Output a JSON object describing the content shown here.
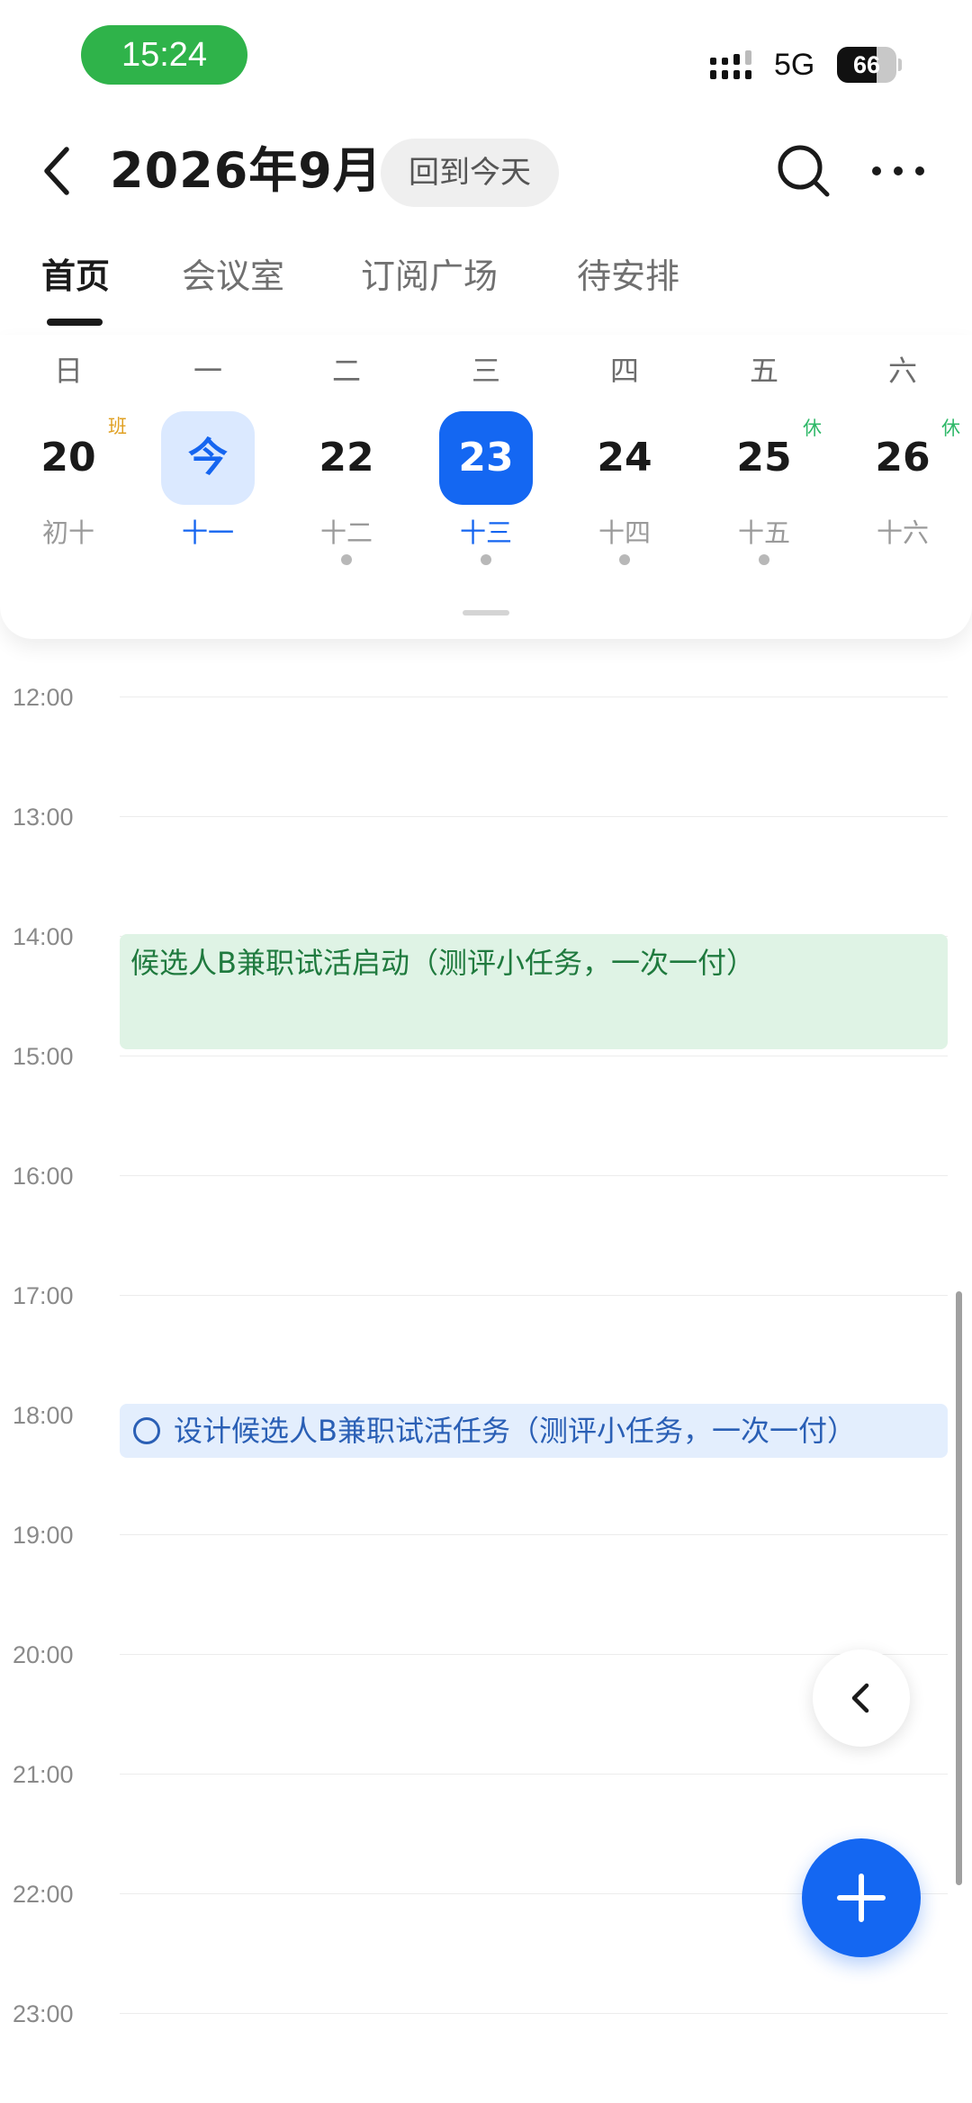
{
  "status_bar": {
    "time": "15:24",
    "network": "5G",
    "battery_level": "66",
    "battery_fraction": 0.66
  },
  "header": {
    "title": "2026年9月",
    "today_button": "回到今天"
  },
  "tabs": [
    {
      "label": "首页",
      "active": true
    },
    {
      "label": "会议室",
      "active": false
    },
    {
      "label": "订阅广场",
      "active": false
    },
    {
      "label": "待安排",
      "active": false
    }
  ],
  "week": {
    "days": [
      {
        "weekday": "日",
        "date": "20",
        "lunar": "初十",
        "badge": "班"
      },
      {
        "weekday": "一",
        "date": "今",
        "lunar": "十一"
      },
      {
        "weekday": "二",
        "date": "22",
        "lunar": "十二"
      },
      {
        "weekday": "三",
        "date": "23",
        "lunar": "十三"
      },
      {
        "weekday": "四",
        "date": "24",
        "lunar": "十四"
      },
      {
        "weekday": "五",
        "date": "25",
        "lunar": "十五",
        "badge": "休"
      },
      {
        "weekday": "六",
        "date": "26",
        "lunar": "十六",
        "badge": "休"
      }
    ]
  },
  "timeline": {
    "hours": [
      "12:00",
      "13:00",
      "14:00",
      "15:00",
      "16:00",
      "17:00",
      "18:00",
      "19:00",
      "20:00",
      "21:00",
      "22:00",
      "23:00"
    ],
    "events": [
      {
        "title": "候选人B兼职试活启动（测评小任务，一次一付）",
        "start": "14:00",
        "end": "15:00"
      },
      {
        "title": "设计候选人B兼职试活任务（测评小任务，一次一付）",
        "start": "18:00",
        "type": "task"
      }
    ]
  },
  "colors": {
    "accent": "#1467f2",
    "today_bg": "#dbe9ff",
    "event_green_bg": "#dff3e5",
    "event_green_text": "#1f7a3e",
    "event_blue_bg": "#e3eefd",
    "event_blue_text": "#2a5fb5",
    "time_pill": "#2fb34a",
    "work_badge": "#e0a021",
    "rest_badge": "#2eb868"
  }
}
